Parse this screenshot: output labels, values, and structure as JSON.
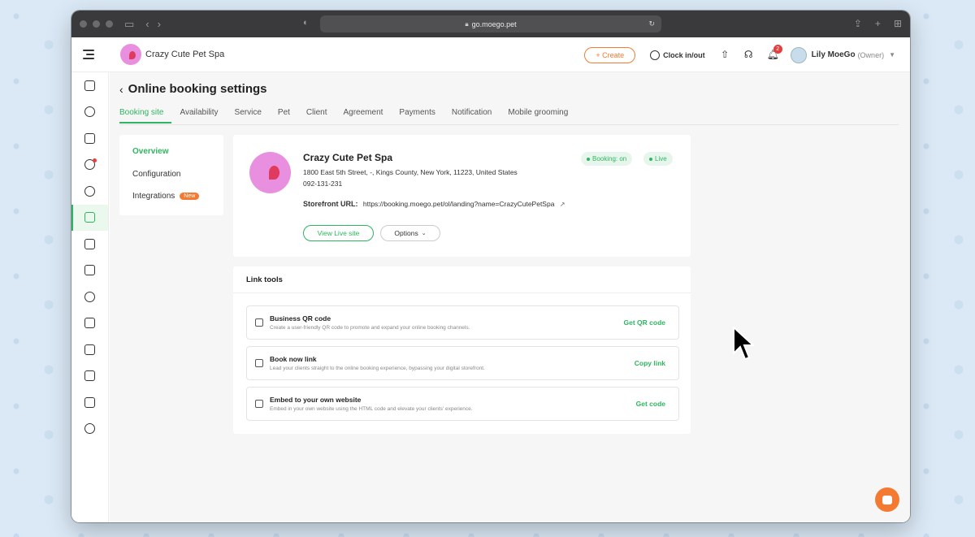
{
  "browser": {
    "url": "go.moego.pet"
  },
  "header": {
    "business_name": "Crazy Cute Pet Spa",
    "create_label": "+ Create",
    "clock_label": "Clock in/out",
    "notification_count": "2",
    "user_name": "Lily MoeGo",
    "user_role": "(Owner)"
  },
  "sidebar": {
    "items": [
      {
        "icon": "calendar-icon"
      },
      {
        "icon": "pet-icon"
      },
      {
        "icon": "clipboard-icon"
      },
      {
        "icon": "message-icon",
        "badge": true
      },
      {
        "icon": "alarm-icon"
      },
      {
        "icon": "online-booking-icon",
        "active": true
      },
      {
        "icon": "client-icon"
      },
      {
        "icon": "retail-icon"
      },
      {
        "icon": "payment-icon"
      },
      {
        "icon": "marketing-icon"
      },
      {
        "icon": "crown-icon"
      },
      {
        "icon": "report-card-icon"
      },
      {
        "icon": "report-icon"
      },
      {
        "icon": "settings-icon"
      }
    ]
  },
  "page": {
    "title": "Online booking settings",
    "tabs": [
      {
        "label": "Booking site",
        "active": true
      },
      {
        "label": "Availability"
      },
      {
        "label": "Service"
      },
      {
        "label": "Pet"
      },
      {
        "label": "Client"
      },
      {
        "label": "Agreement"
      },
      {
        "label": "Payments"
      },
      {
        "label": "Notification"
      },
      {
        "label": "Mobile grooming"
      }
    ]
  },
  "subnav": {
    "items": [
      {
        "label": "Overview",
        "active": true
      },
      {
        "label": "Configuration"
      },
      {
        "label": "Integrations",
        "badge": "New"
      }
    ]
  },
  "profile": {
    "name": "Crazy Cute Pet Spa",
    "address": "1800 East 5th Street, -, Kings County, New York, 11223, United States",
    "phone": "092-131-231",
    "storefront_label": "Storefront URL:",
    "storefront_url": "https://booking.moego.pet/ol/landing?name=CrazyCutePetSpa",
    "booking_status": "Booking: on",
    "live_status": "Live",
    "view_live_label": "View Live site",
    "options_label": "Options"
  },
  "link_tools": {
    "title": "Link tools",
    "rows": [
      {
        "icon": "qr-code-icon",
        "title": "Business QR code",
        "desc": "Create a user-friendly QR code to promote and expand your online booking channels.",
        "action": "Get QR code"
      },
      {
        "icon": "calendar-link-icon",
        "title": "Book now link",
        "desc": "Lead your clients straight to the online booking experience, bypassing your digital storefront.",
        "action": "Copy link"
      },
      {
        "icon": "code-icon",
        "title": "Embed to your own website",
        "desc": "Embed in your own website using the HTML code and elevate your clients' experience.",
        "action": "Get code"
      }
    ]
  },
  "colors": {
    "accent": "#2fb561",
    "brand_orange": "#f47a32",
    "chrome": "#3a3a3c"
  }
}
